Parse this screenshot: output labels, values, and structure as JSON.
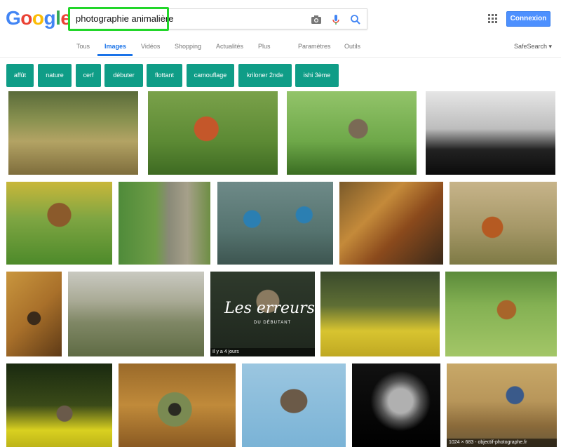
{
  "logo": {
    "letters": [
      "G",
      "o",
      "o",
      "g",
      "l",
      "e"
    ],
    "colors": [
      "#4285f4",
      "#ea4335",
      "#fbbc05",
      "#4285f4",
      "#34a853",
      "#ea4335"
    ]
  },
  "search": {
    "value": "photographie animalière"
  },
  "header": {
    "connexion": "Connexion"
  },
  "tabs": [
    "Tous",
    "Images",
    "Vidéos",
    "Shopping",
    "Actualités",
    "Plus",
    "Paramètres",
    "Outils"
  ],
  "active_tab": "Images",
  "safesearch": "SafeSearch ▾",
  "chips": [
    "affût",
    "nature",
    "cerf",
    "débuter",
    "flottant",
    "camouflage",
    "kriloner 2nde",
    "ishi 3ème"
  ],
  "chip_color": "#0f9d87",
  "images": [
    {
      "desc": "deer in tall grass",
      "bg": "linear-gradient(180deg,#5a6b3a 0%,#8a9250 35%,#b3a364 60%,#7e6d3c 100%)",
      "caption": ""
    },
    {
      "desc": "red squirrel jumping",
      "bg": "radial-gradient(circle at 45% 45%,#c4572a 0 14%,transparent 15%),linear-gradient(180deg,#7aa14a 0%,#5c8a34 60%,#3e6a22 100%)",
      "caption": ""
    },
    {
      "desc": "sparrow on mossy rock",
      "bg": "radial-gradient(circle at 55% 45%,#7a6a55 0 11%,transparent 12%),linear-gradient(180deg,#93c46a 0%,#6ea849 60%,#3a6d22 100%)",
      "caption": ""
    },
    {
      "desc": "stag silhouette",
      "bg": "linear-gradient(180deg,#e6e6e6 0%,#bdbdbd 45%,#222 70%,#0b0b0b 100%)",
      "caption": ""
    },
    {
      "desc": "roe deer in meadow",
      "bg": "radial-gradient(circle at 50% 40%,#8b5a2b 0 16%,transparent 17%),linear-gradient(180deg,#c9b73a 0%,#7ea542 45%,#4d8a2a 100%)",
      "caption": ""
    },
    {
      "desc": "woodpecker on tree",
      "bg": "linear-gradient(90deg,#4f8b3a 0%,#6e9c46 40%,#8a8a78 55%,#a6a08a 75%,#6e8e44 100%)",
      "caption": ""
    },
    {
      "desc": "two kingfishers on branch",
      "bg": "radial-gradient(circle at 30% 45%,#2b7fb2 0 9%,transparent 10%),radial-gradient(circle at 75% 40%,#2b7fb2 0 8%,transparent 9%),linear-gradient(180deg,#6e8a88 0%,#55736f 60%,#3d5550 100%)",
      "caption": ""
    },
    {
      "desc": "giraffe and squirrel",
      "bg": "linear-gradient(135deg,#7a5a2a 0%,#c48a3a 35%,#8b4a1c 60%,#3a2a1a 100%)",
      "caption": ""
    },
    {
      "desc": "fox in field",
      "bg": "radial-gradient(circle at 40% 55%,#b55a22 0 13%,transparent 14%),linear-gradient(180deg,#c7b48a 0%,#a69868 55%,#7e7a45 100%)",
      "caption": ""
    },
    {
      "desc": "snarling leopard",
      "bg": "radial-gradient(circle at 50% 55%,#3a2a1a 0 12%,transparent 13%),linear-gradient(135deg,#c9963e 0%,#a9702a 50%,#5e3a16 100%)",
      "caption": ""
    },
    {
      "desc": "camouflaged photographer under tree",
      "bg": "linear-gradient(180deg,#c9c9c1 0%,#a9aa95 35%,#7f8765 60%,#5f6b44 100%)",
      "caption": ""
    },
    {
      "desc": "owl with text overlay",
      "bg": "radial-gradient(circle at 55% 35%,#8a7a60 0 14%,transparent 15%),linear-gradient(180deg,#2f3a2c 0%,#1e261d 100%)",
      "caption": "Il y a 4 jours",
      "overlay": "Les erreurs",
      "overlay_sub": "DU DÉBUTANT"
    },
    {
      "desc": "photographer with camera rigs",
      "bg": "linear-gradient(180deg,#3a4a2c 0%,#5e6e34 40%,#d8c430 70%,#bfa822 100%)",
      "caption": ""
    },
    {
      "desc": "running deer",
      "bg": "radial-gradient(circle at 55% 45%,#a8652a 0 12%,transparent 13%),linear-gradient(180deg,#5b8a3a 0%,#84b153 40%,#a3c667 100%)",
      "caption": ""
    },
    {
      "desc": "rabbit in yellow flowers",
      "bg": "radial-gradient(circle at 55% 60%,#6a5a4a 0 10%,transparent 11%),linear-gradient(180deg,#1a2a10 0%,#3a4a18 50%,#d9d020 80%,#bdb418 100%)",
      "caption": ""
    },
    {
      "desc": "camouflaged lens",
      "bg": "radial-gradient(circle at 48% 55%,#2a2a22 0 8%,#7a8a52 9% 22%,transparent 23%),linear-gradient(180deg,#9a6a2a 0%,#c08a3a 50%,#8a5a22 100%)",
      "caption": ""
    },
    {
      "desc": "vulture in flight",
      "bg": "radial-gradient(ellipse at 50% 45%,#6b5a48 0 18%,transparent 19%),linear-gradient(180deg,#9bc6e0 0%,#7ab3d6 100%)",
      "caption": ""
    },
    {
      "desc": "lion black and white",
      "bg": "radial-gradient(circle at 55% 45%,#b0b0b0 0 18%,#555 30%,transparent 45%),linear-gradient(180deg,#111 0%,#000 100%)",
      "caption": ""
    },
    {
      "desc": "blue tit landing on water",
      "bg": "radial-gradient(circle at 62% 38%,#3a5a8a 0 10%,transparent 11%),linear-gradient(180deg,#c8a868 0%,#b8965a 45%,#8a6a3a 75%,#6a5a3a 100%)",
      "caption": "1024 × 683 - objectif-photographe.fr"
    }
  ]
}
